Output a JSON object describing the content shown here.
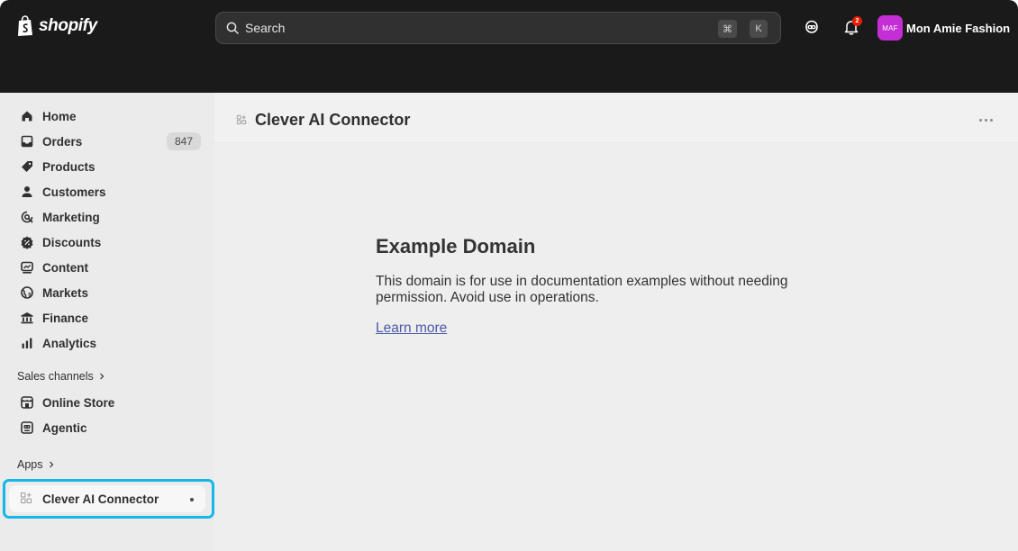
{
  "topbar": {
    "brand": "shopify",
    "search": {
      "placeholder": "Search",
      "shortcut_modifier": "⌘",
      "shortcut_key": "K"
    },
    "notifications_count": "2",
    "store": {
      "initials": "MAF",
      "name": "Mon Amie Fashion",
      "avatar_color": "#c32fd4"
    }
  },
  "sidebar": {
    "items": [
      {
        "label": "Home",
        "icon": "home-icon"
      },
      {
        "label": "Orders",
        "icon": "orders-icon",
        "count": "847"
      },
      {
        "label": "Products",
        "icon": "tag-icon"
      },
      {
        "label": "Customers",
        "icon": "person-icon"
      },
      {
        "label": "Marketing",
        "icon": "target-icon"
      },
      {
        "label": "Discounts",
        "icon": "discount-icon"
      },
      {
        "label": "Content",
        "icon": "content-icon"
      },
      {
        "label": "Markets",
        "icon": "globe-icon"
      },
      {
        "label": "Finance",
        "icon": "bank-icon"
      },
      {
        "label": "Analytics",
        "icon": "bar-chart-icon"
      }
    ],
    "sales_channels": {
      "heading": "Sales channels",
      "items": [
        {
          "label": "Online Store",
          "icon": "store-icon"
        },
        {
          "label": "Agentic",
          "icon": "robot-icon"
        }
      ]
    },
    "apps": {
      "heading": "Apps",
      "items": [
        {
          "label": "Clever AI Connector",
          "icon": "app-icon"
        }
      ]
    },
    "highlight_color": "#16b6e8"
  },
  "main": {
    "title": "Clever AI Connector",
    "content": {
      "heading": "Example Domain",
      "body": "This domain is for use in documentation examples without needing permission. Avoid use in operations.",
      "link": "Learn more"
    }
  }
}
